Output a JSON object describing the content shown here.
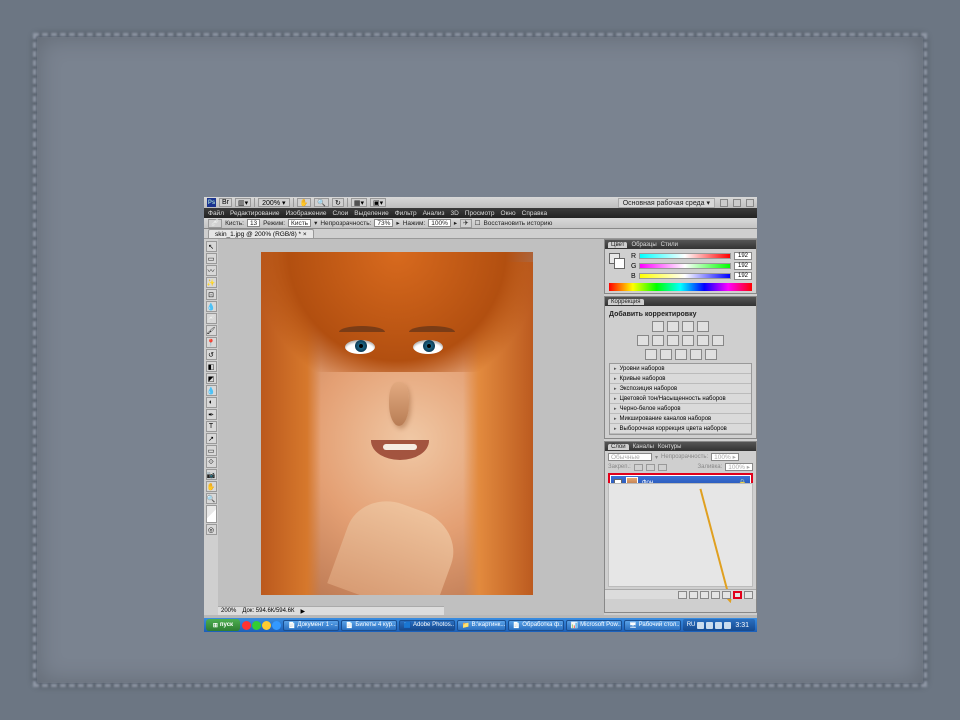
{
  "appbar": {
    "zoom": "200%  ▾",
    "workspace": "Основная рабочая среда  ▾"
  },
  "menu": [
    "Файл",
    "Редактирование",
    "Изображение",
    "Слои",
    "Выделение",
    "Фильтр",
    "Анализ",
    "3D",
    "Просмотр",
    "Окно",
    "Справка"
  ],
  "options": {
    "tool_label": "Кисть:",
    "brush_size": "13",
    "mode_label": "Режим:",
    "mode_value": "Кисть",
    "opacity_label": "Непрозрачность:",
    "opacity_value": "73%",
    "flow_label": "Нажим:",
    "flow_value": "100%",
    "history": "Восстановить историю"
  },
  "doc_tab": "skin_1.jpg @ 200% (RGB/8) *   ×",
  "status": {
    "zoom": "200%",
    "doc": "Док: 594.6К/594.6К",
    "arrow": "▶"
  },
  "color_panel": {
    "tabs": [
      "Цвет",
      "Образцы",
      "Стили"
    ],
    "r": "192",
    "g": "192",
    "b": "192",
    "labels": {
      "r": "R",
      "g": "G",
      "b": "B"
    }
  },
  "adjust_panel": {
    "tab": "Коррекция",
    "title": "Добавить корректировку",
    "presets": [
      "Уровни наборов",
      "Кривые наборов",
      "Экспозиция наборов",
      "Цветовой тон/Насыщенность наборов",
      "Черно-белое наборов",
      "Микширование каналов наборов",
      "Выборочная коррекция цвета наборов"
    ]
  },
  "layers_panel": {
    "tabs": [
      "Слои",
      "Каналы",
      "Контуры"
    ],
    "blend": "Обычные",
    "opacity_label": "Непрозрачность:",
    "opacity": "100%  ▸",
    "lock_label": "Закреп.:",
    "fill_label": "Заливка:",
    "fill": "100%  ▸",
    "layer_name": "Фон",
    "lock_icon": "🔒"
  },
  "taskbar": {
    "start": "пуск",
    "items": [
      "Документ 1 - ...",
      "Билеты 4 кур...",
      "Adobe Photos...",
      "В:\\картинк...",
      "Обработка ф...",
      "Microsoft Pow...",
      "Рабочий стол..."
    ],
    "lang": "RU",
    "time": "3:31"
  }
}
